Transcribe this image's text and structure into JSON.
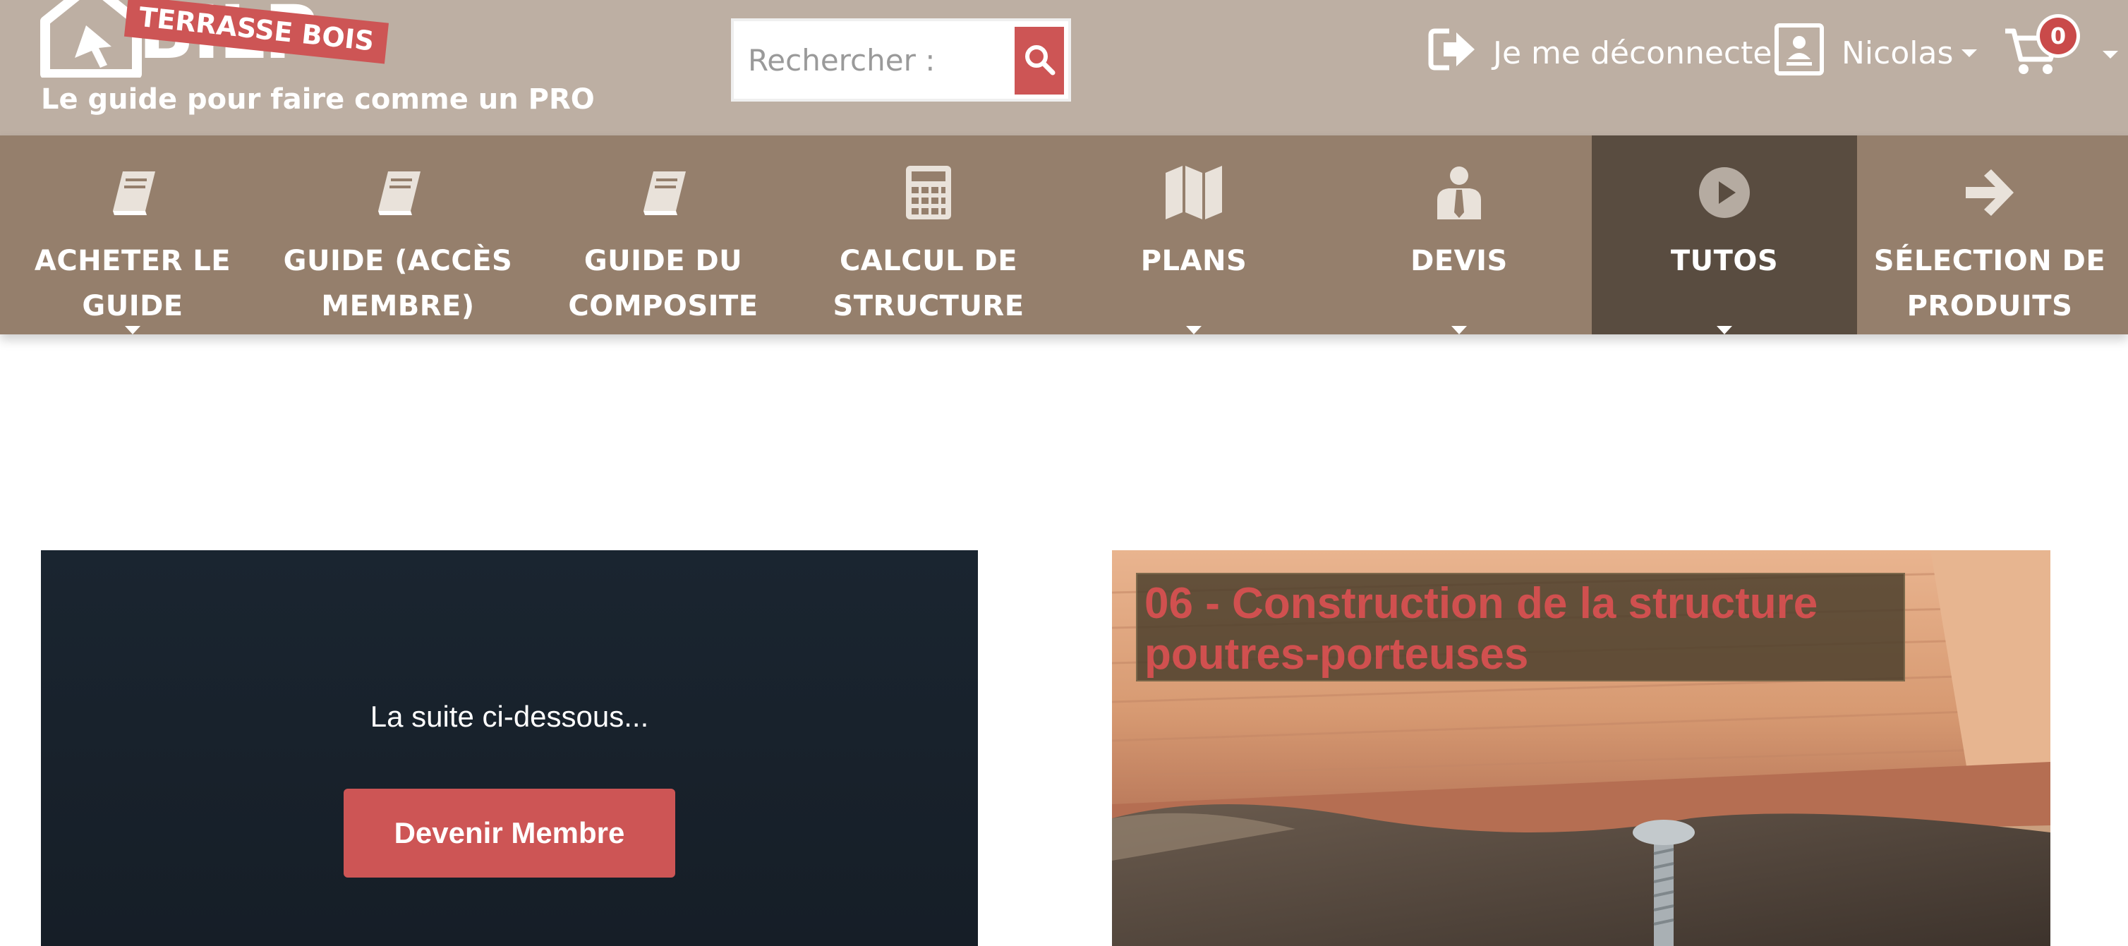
{
  "header": {
    "brand_badge": "TERRASSE BOIS",
    "brand_wordmark": "BILP",
    "tagline": "Le guide pour faire comme un PRO",
    "search_placeholder": "Rechercher :",
    "logout_label": "Je me déconnecte",
    "user_name": "Nicolas",
    "cart_count": "0",
    "icons": {
      "logo": "house-cursor-logo-icon",
      "search": "search-icon",
      "logout": "sign-out-icon",
      "user": "user-card-icon",
      "cart": "shopping-cart-icon"
    }
  },
  "nav": {
    "items": [
      {
        "line1": "ACHETER LE",
        "line2": "GUIDE",
        "icon": "book-icon",
        "submenu": true,
        "active": false
      },
      {
        "line1": "GUIDE (ACCÈS",
        "line2": "MEMBRE)",
        "icon": "book-icon",
        "submenu": false,
        "active": false
      },
      {
        "line1": "GUIDE DU",
        "line2": "COMPOSITE",
        "icon": "book-icon",
        "submenu": false,
        "active": false
      },
      {
        "line1": "CALCUL DE",
        "line2": "STRUCTURE",
        "icon": "calculator-icon",
        "submenu": false,
        "active": false
      },
      {
        "line1": "PLANS",
        "line2": "",
        "icon": "map-icon",
        "submenu": true,
        "active": false
      },
      {
        "line1": "DEVIS",
        "line2": "",
        "icon": "user-tie-icon",
        "submenu": true,
        "active": false
      },
      {
        "line1": "TUTOS",
        "line2": "",
        "icon": "play-circle-icon",
        "submenu": true,
        "active": true
      },
      {
        "line1": "SÉLECTION DE",
        "line2": "PRODUITS",
        "icon": "arrow-right-icon",
        "submenu": false,
        "active": false
      }
    ]
  },
  "main": {
    "promo_text": "La suite ci-dessous...",
    "promo_button": "Devenir Membre",
    "video_title_line1": "06 - Construction de la structure",
    "video_title_line2": "poutres-porteuses"
  },
  "colors": {
    "header_bg": "#bdafa3",
    "nav_bg": "#957f6c",
    "nav_active_bg": "#594c40",
    "accent_red": "#cd5555",
    "promo_bg": "#1a2530"
  }
}
